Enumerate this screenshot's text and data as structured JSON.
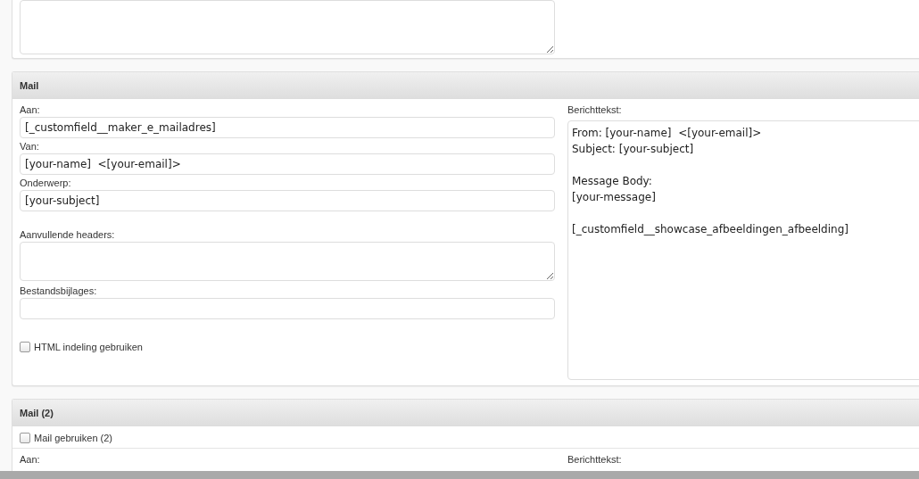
{
  "top_panel": {
    "kind": "textarea"
  },
  "mail": {
    "title": "Mail",
    "fields": [
      {
        "kind": "input",
        "label": "Aan:",
        "value": "[_customfield__maker_e_mailadres]"
      },
      {
        "kind": "input",
        "label": "Van:",
        "value": "[your-name]  <[your-email]>"
      },
      {
        "kind": "input",
        "label": "Onderwerp:",
        "value": "[your-subject]"
      },
      {
        "kind": "textarea",
        "label": "Aanvullende headers:"
      },
      {
        "kind": "input",
        "label": "Bestandsbijlages:"
      }
    ],
    "html_checkbox": {
      "label": "HTML indeling gebruiken",
      "checked": false
    },
    "body_label": "Berichttekst:",
    "body": "From: [your-name]  <[your-email]>\nSubject: [your-subject]\n\nMessage Body:\n[your-message]\n\n[_customfield__showcase_afbeeldingen_afbeelding]"
  },
  "mail2": {
    "title": "Mail (2)",
    "use_checkbox": {
      "label": "Mail gebruiken (2)",
      "checked": false
    },
    "left_label": "Aan:",
    "right_label": "Berichttekst:"
  }
}
